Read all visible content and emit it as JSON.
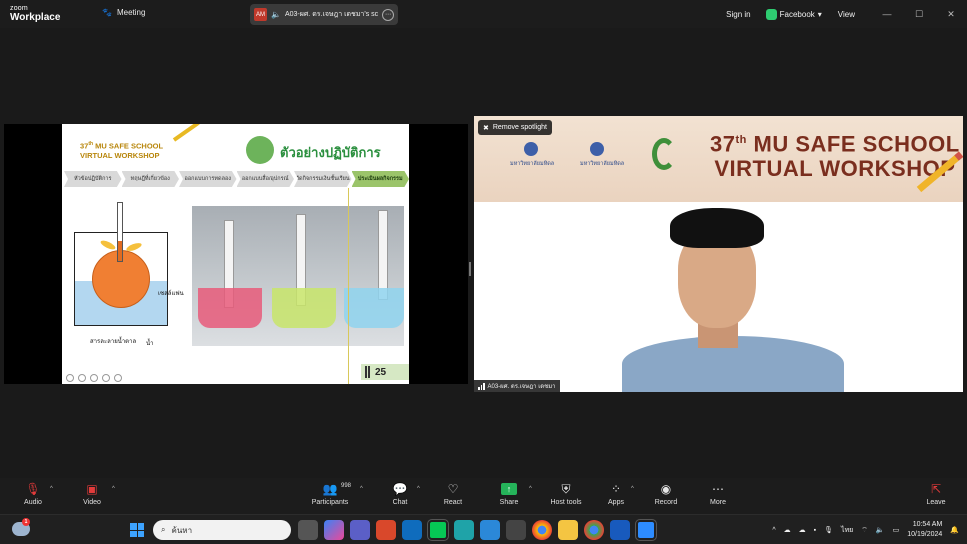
{
  "app": {
    "logo_line1": "zoom",
    "logo_line2": "Workplace",
    "meeting_label": "Meeting"
  },
  "share_pill": {
    "badge": "AM",
    "text": "A03-ผศ. ดร.เจษฎา เดชมา's sc"
  },
  "top_right": {
    "sign_in": "Sign in",
    "facebook": "Facebook",
    "view": "View"
  },
  "slide": {
    "title_number": "37",
    "title_suffix": "th",
    "title_rest": " MU SAFE SCHOOL",
    "title_line2": "VIRTUAL WORKSHOP",
    "heading": "ตัวอย่างปฏิบัติการ",
    "tabs": [
      "หัวข้อปฏิบัติการ",
      "ทฤษฎีที่เกี่ยวข้อง",
      "ออกแบบการทดลอง",
      "ออกแบบสื่อ/อุปกรณ์",
      "จัดกิจกรรมเงินชั้นเรียน",
      "ประเมินผลกิจกรรม"
    ],
    "label_cell": "เซลล์แฟน",
    "label_sugar": "สารละลายน้ำตาล",
    "label_water": "น้ำ",
    "page_number": "25"
  },
  "speaker": {
    "remove_spotlight": "Remove spotlight",
    "name": "A03-ผศ. ดร.เจษฎา เดชมา",
    "banner_small_1": "มหาวิทยาลัยมหิดล",
    "banner_small_2": "มหาวิทยาลัยมหิดล",
    "banner_number": "37",
    "banner_suffix": "th",
    "banner_rest": " MU SAFE SCHOOL",
    "banner_line2": "VIRTUAL WORKSHOP"
  },
  "toolbar": {
    "audio": "Audio",
    "video": "Video",
    "participants": "Participants",
    "participants_count": "998",
    "chat": "Chat",
    "react": "React",
    "share": "Share",
    "host_tools": "Host tools",
    "apps": "Apps",
    "record": "Record",
    "more": "More",
    "leave": "Leave"
  },
  "taskbar": {
    "search_placeholder": "ค้นหา",
    "weather_badge": "1",
    "lang": "ไทย",
    "time": "10:54 AM",
    "date": "10/19/2024"
  },
  "colors": {
    "share_green": "#25b35a",
    "slide_green": "#2a8f3e",
    "active_tab": "#9bc46a",
    "mute_red": "#e23b3b"
  }
}
